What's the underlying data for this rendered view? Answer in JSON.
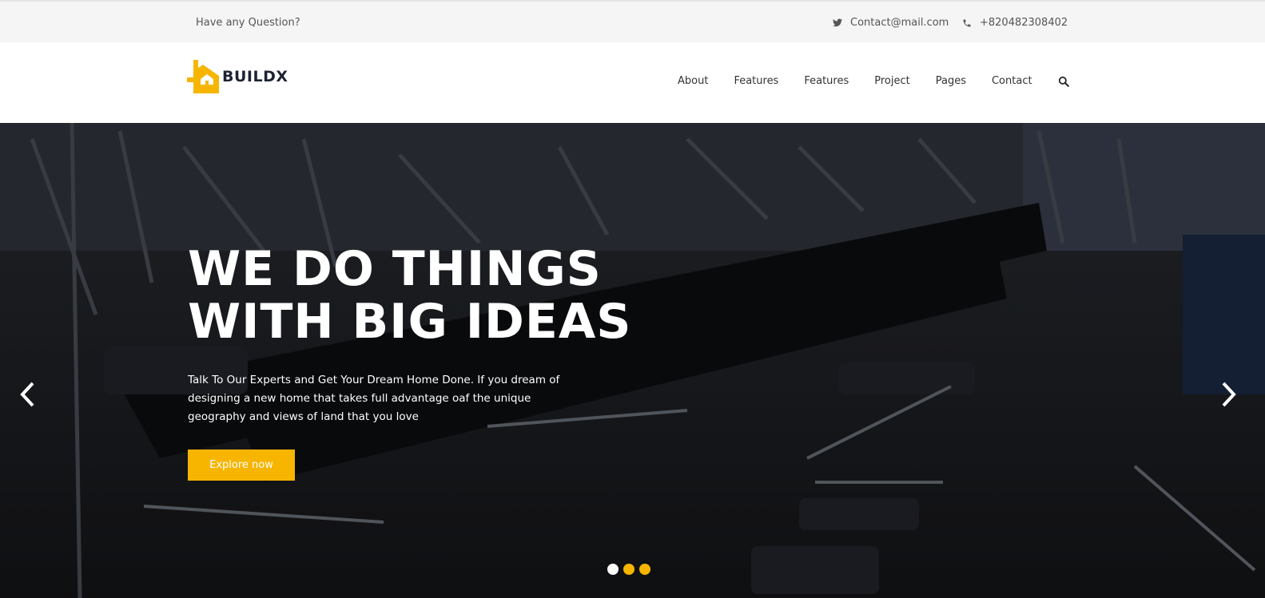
{
  "topbar": {
    "question": "Have any Question?",
    "email": "Contact@mail.com",
    "phone": "+820482308402"
  },
  "logo": {
    "text": "BUILDX",
    "color": "#f7b500"
  },
  "nav": {
    "items": [
      "About",
      "Features",
      "Features",
      "Project",
      "Pages",
      "Contact"
    ],
    "search_icon": "search-icon"
  },
  "hero": {
    "title_line1": "WE DO THINGS",
    "title_line2": "WITH BIG IDEAS",
    "subtitle": "Talk To Our Experts and Get Your Dream Home Done. If you dream of designing a new home that takes full advantage oaf the unique geography and views of land that you love",
    "cta_label": "Explore now",
    "prev_icon": "chevron-left-icon",
    "next_icon": "chevron-right-icon",
    "slides_count": 3,
    "active_slide": 1
  },
  "colors": {
    "accent": "#f7b500",
    "dark": "#1d2331"
  }
}
